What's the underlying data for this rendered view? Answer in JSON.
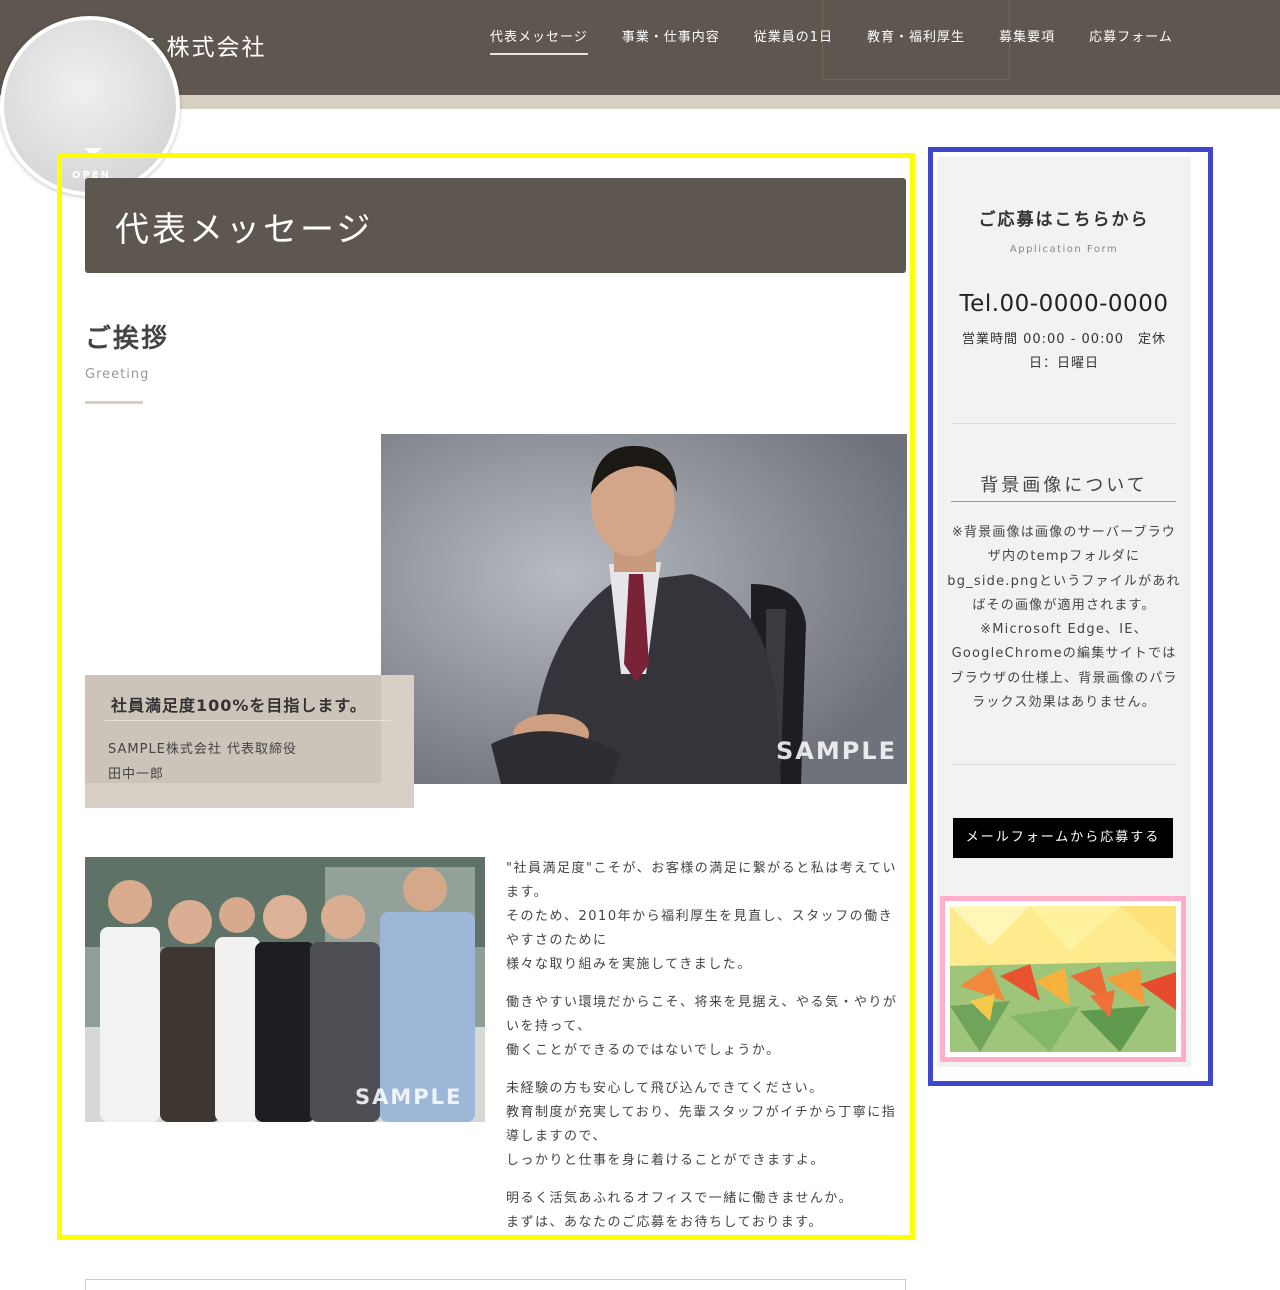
{
  "header": {
    "logo": "PLE 株式会社",
    "nav": [
      {
        "label": "代表メッセージ",
        "active": true
      },
      {
        "label": "事業・仕事内容",
        "active": false
      },
      {
        "label": "従業員の1日",
        "active": false
      },
      {
        "label": "教育・福利厚生",
        "active": false
      },
      {
        "label": "募集要項",
        "active": false
      },
      {
        "label": "応募フォーム",
        "active": false
      }
    ],
    "open_label": "OPEN"
  },
  "main": {
    "page_title": "代表メッセージ",
    "section_title": "ご挨拶",
    "section_sub": "Greeting",
    "ceo_watermark": "SAMPLE",
    "caption": {
      "title": "社員満足度100%を目指します。",
      "line1": "SAMPLE株式会社 代表取締役",
      "line2": "田中一郎"
    },
    "team_watermark": "SAMPLE",
    "paragraphs": [
      [
        "\"社員満足度\"こそが、お客様の満足に繋がると私は考えています。",
        "そのため、2010年から福利厚生を見直し、スタッフの働きやすさのために",
        "様々な取り組みを実施してきました。"
      ],
      [
        "働きやすい環境だからこそ、将来を見据え、やる気・やりがいを持って、",
        "働くことができるのではないでしょうか。"
      ],
      [
        "未経験の方も安心して飛び込んできてください。",
        "教育制度が充実しており、先輩スタッフがイチから丁寧に指導しますので、",
        "しっかりと仕事を身に着けることができますよ。"
      ],
      [
        "明るく活気あふれるオフィスで一緒に働きませんか。",
        "まずは、あなたのご応募をお待ちしております。"
      ]
    ]
  },
  "sidebar": {
    "apply_title": "ご応募はこちらから",
    "apply_sub": "Application Form",
    "tel": "Tel.00-0000-0000",
    "hours": "営業時間 00:00 - 00:00　定休日：日曜日",
    "bg_title": "背景画像について",
    "bg_text": "※背景画像は画像のサーバーブラウザ内のtempフォルダにbg_side.pngというファイルがあればその画像が適用されます。※Microsoft Edge、IE、GoogleChromeの編集サイトではブラウザの仕様上、背景画像のパララックス効果はありません。",
    "button": "メールフォームから応募する"
  },
  "colors": {
    "header_bg": "#5e5750",
    "header_strip": "#d9d0c4",
    "highlight_main": "#ffff00",
    "highlight_side": "#3f48cc",
    "highlight_image": "#ffaec9"
  }
}
